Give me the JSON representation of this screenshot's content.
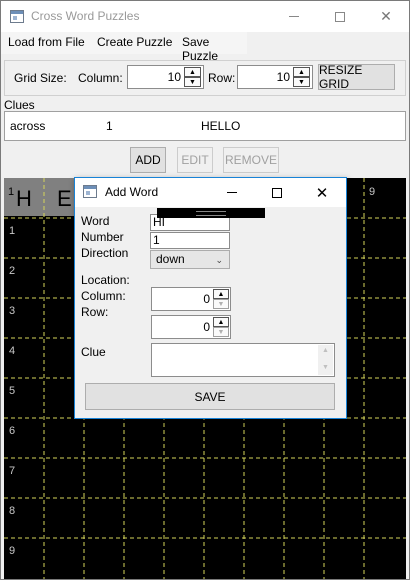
{
  "window": {
    "title": "Cross Word Puzzles",
    "minimize_glyph": "",
    "maximize_glyph": "",
    "close_glyph": "✕"
  },
  "menu": {
    "items": [
      "Load from File",
      "Create Puzzle",
      "Save Puzzle"
    ]
  },
  "toolbar": {
    "grid_size_label": "Grid Size:",
    "column_label": "Column:",
    "column_value": "10",
    "row_label": "Row:",
    "row_value": "10",
    "resize_label": "RESIZE GRID"
  },
  "clues": {
    "label": "Clues",
    "rows": [
      {
        "direction": "across",
        "number": "1",
        "word": "HELLO"
      }
    ],
    "add_label": "ADD",
    "edit_label": "EDIT",
    "remove_label": "REMOVE"
  },
  "grid": {
    "size": 10,
    "row_numbers": [
      "1",
      "2",
      "3",
      "4",
      "5",
      "6",
      "7",
      "8",
      "9"
    ],
    "top_row_number_right": "9",
    "letters": [
      "H",
      "E"
    ],
    "first_cell_number": "1"
  },
  "dialog": {
    "title": "Add Word",
    "close_glyph": "✕",
    "word_label": "Word",
    "word_value": "HI",
    "number_label": "Number",
    "number_value": "1",
    "direction_label": "Direction",
    "direction_value": "down",
    "location_label": "Location:",
    "column_label": "Column:",
    "column_value": "0",
    "row_label": "Row:",
    "row_value": "0",
    "clue_label": "Clue",
    "clue_value": "",
    "save_label": "SAVE"
  },
  "icons": {
    "spin_up": "▲",
    "spin_down": "▼",
    "chevron": "⌄"
  },
  "colors": {
    "grid_background": "#000000",
    "grid_lines": "#d4d45a",
    "highlight_cell": "#808080",
    "dialog_border": "#1883d7"
  }
}
